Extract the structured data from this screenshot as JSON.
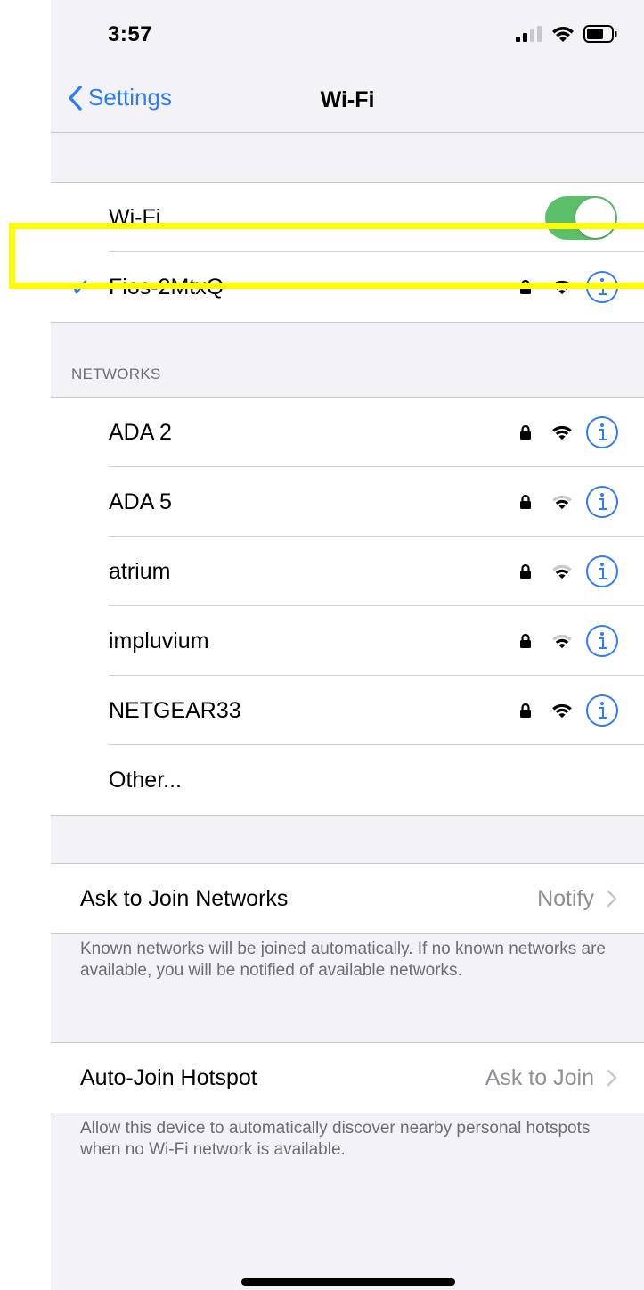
{
  "status_bar": {
    "time": "3:57"
  },
  "nav": {
    "back_label": "Settings",
    "title": "Wi-Fi"
  },
  "wifi_toggle": {
    "label": "Wi-Fi",
    "on": true
  },
  "connected_network": {
    "name": "Fios-2MtxQ",
    "checkmark": "✓",
    "locked": true,
    "signal": "full"
  },
  "networks_header": "NETWORKS",
  "networks": [
    {
      "name": "ADA 2",
      "locked": true,
      "signal": "full"
    },
    {
      "name": "ADA 5",
      "locked": true,
      "signal": "medium"
    },
    {
      "name": "atrium",
      "locked": true,
      "signal": "medium"
    },
    {
      "name": "impluvium",
      "locked": true,
      "signal": "medium"
    },
    {
      "name": "NETGEAR33",
      "locked": true,
      "signal": "full"
    }
  ],
  "other_label": "Other...",
  "ask_to_join": {
    "label": "Ask to Join Networks",
    "value": "Notify",
    "footnote": "Known networks will be joined automatically. If no known networks are available, you will be notified of available networks."
  },
  "auto_join_hotspot": {
    "label": "Auto-Join Hotspot",
    "value": "Ask to Join",
    "footnote": "Allow this device to automatically discover nearby personal hotspots when no Wi-Fi network is available."
  },
  "colors": {
    "accent": "#2f7cf6",
    "toggle_on": "#5cbf6a",
    "highlight": "#fffb00"
  }
}
